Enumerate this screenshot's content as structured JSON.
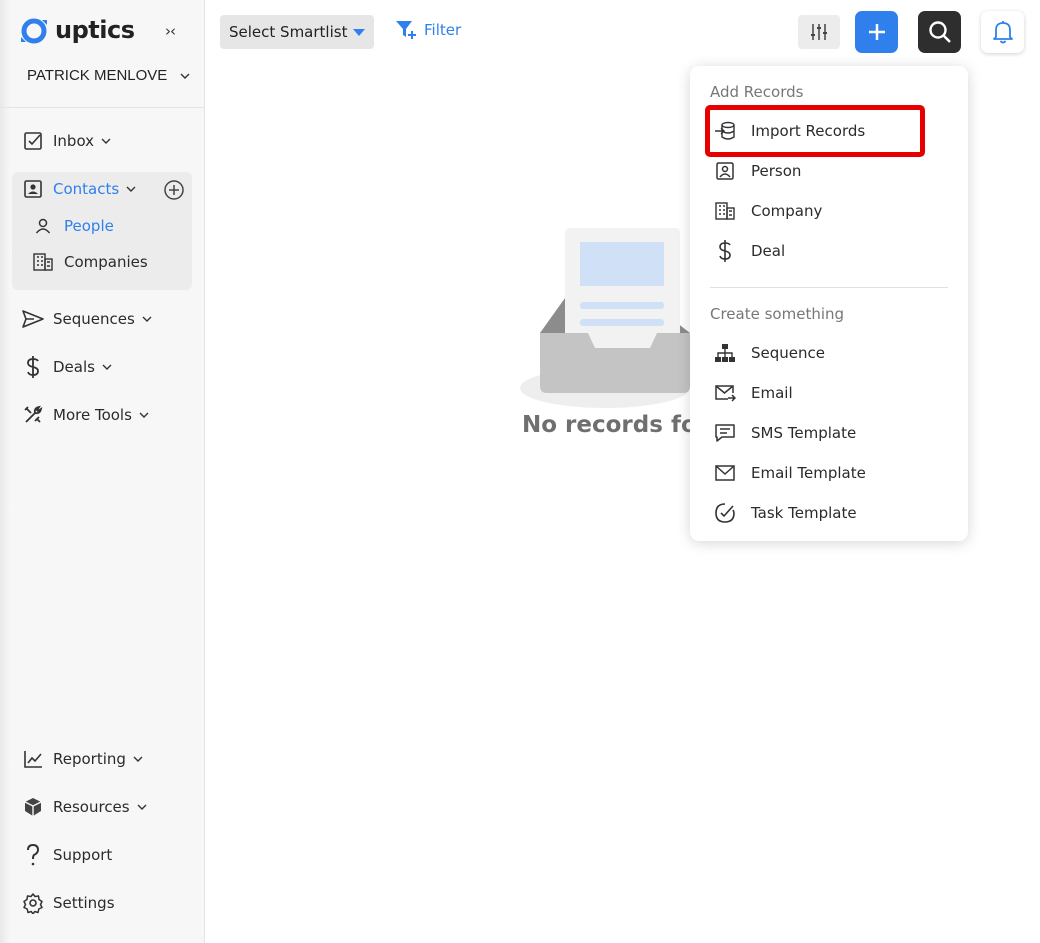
{
  "app": {
    "name": "uptics",
    "collapse_glyph": "›‹"
  },
  "user": {
    "name": "PATRICK MENLOVE"
  },
  "sidebar": {
    "items": [
      {
        "label": "Inbox",
        "icon": "inbox-check-icon"
      },
      {
        "label": "Contacts",
        "icon": "contact-card-icon"
      },
      {
        "label": "Sequences",
        "icon": "send-icon"
      },
      {
        "label": "Deals",
        "icon": "dollar-icon"
      },
      {
        "label": "More Tools",
        "icon": "tools-icon"
      },
      {
        "label": "Reporting",
        "icon": "chart-line-icon"
      },
      {
        "label": "Resources",
        "icon": "box-icon"
      },
      {
        "label": "Support",
        "icon": "question-icon"
      },
      {
        "label": "Settings",
        "icon": "gear-icon"
      }
    ],
    "contacts_sub": [
      {
        "label": "People",
        "icon": "person-icon",
        "active": true
      },
      {
        "label": "Companies",
        "icon": "building-icon",
        "active": false
      }
    ]
  },
  "toolbar": {
    "smartlist_label": "Select Smartlist",
    "filter_label": "Filter"
  },
  "empty_state": {
    "text": "No records found"
  },
  "menu": {
    "add_records_heading": "Add Records",
    "add_records": [
      {
        "label": "Import Records",
        "icon": "database-import-icon",
        "highlighted": true
      },
      {
        "label": "Person",
        "icon": "person-card-icon"
      },
      {
        "label": "Company",
        "icon": "building-icon"
      },
      {
        "label": "Deal",
        "icon": "dollar-icon"
      }
    ],
    "create_heading": "Create something",
    "create": [
      {
        "label": "Sequence",
        "icon": "hierarchy-icon"
      },
      {
        "label": "Email",
        "icon": "email-send-icon"
      },
      {
        "label": "SMS Template",
        "icon": "sms-icon"
      },
      {
        "label": "Email Template",
        "icon": "envelope-icon"
      },
      {
        "label": "Task Template",
        "icon": "task-check-icon"
      }
    ]
  },
  "colors": {
    "accent": "#2f80ed",
    "highlight": "#e60000",
    "dark_button": "#2e2e2e"
  }
}
